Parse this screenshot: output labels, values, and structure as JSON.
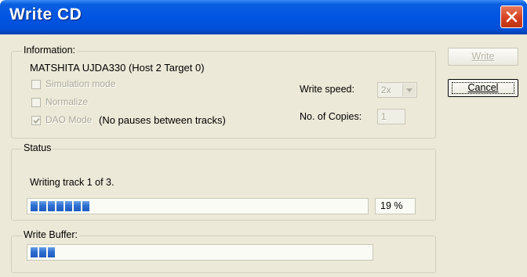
{
  "window": {
    "title": "Write CD"
  },
  "information": {
    "label": "Information:",
    "drive": "MATSHITA UJDA330 (Host 2 Target 0)",
    "simulation_label": "Simulation mode",
    "normalize_label": "Normalize",
    "dao_label": "DAO Mode",
    "dao_note": "(No pauses between tracks)",
    "write_speed_label": "Write speed:",
    "write_speed_value": "2x",
    "copies_label": "No. of Copies:",
    "copies_value": "1"
  },
  "status": {
    "label": "Status",
    "message": "Writing track 1 of 3.",
    "progress_text": "19 %",
    "progress_fraction": 0.19
  },
  "buffer": {
    "label": "Write Buffer:",
    "fill_fraction": 0.1
  },
  "buttons": {
    "write_label": "Write",
    "cancel_label": "Cancel"
  },
  "colors": {
    "title_bar": "#0054e3",
    "progress_block": "#2f6fd1",
    "close_button": "#d64020"
  }
}
